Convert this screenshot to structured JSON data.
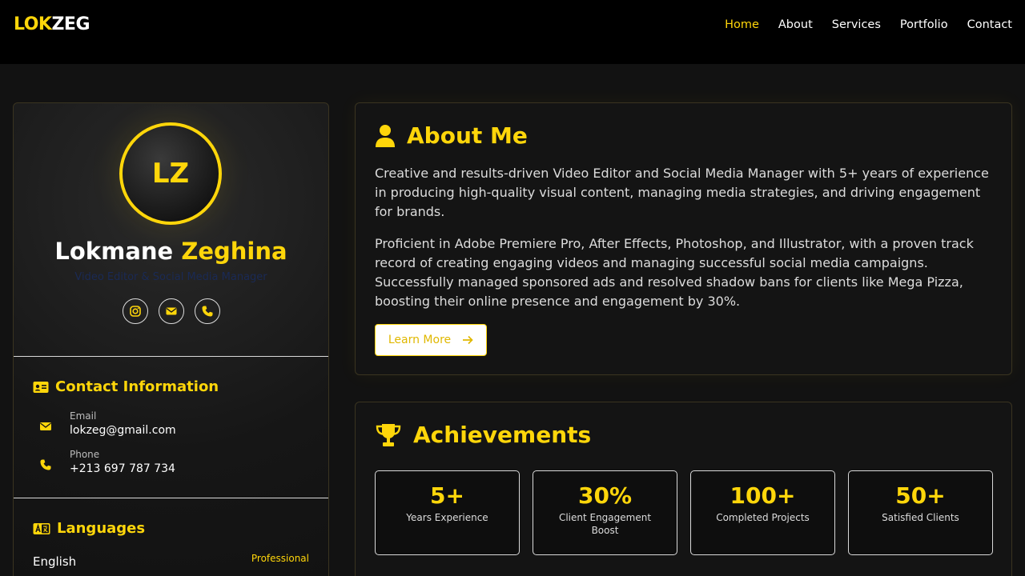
{
  "brand": {
    "part1": "LOK",
    "part2": "ZEG"
  },
  "nav": {
    "items": [
      {
        "label": "Home",
        "active": true
      },
      {
        "label": "About"
      },
      {
        "label": "Services"
      },
      {
        "label": "Portfolio"
      },
      {
        "label": "Contact"
      }
    ]
  },
  "profile": {
    "initials": "LZ",
    "first_name": "Lokmane",
    "last_name": "Zeghina",
    "role": "Video Editor & Social Media Manager",
    "socials": [
      "instagram-icon",
      "envelope-icon",
      "phone-icon"
    ]
  },
  "contact": {
    "title": "Contact Information",
    "email_label": "Email",
    "email_value": "lokzeg@gmail.com",
    "phone_label": "Phone",
    "phone_value": "+213 697 787 734"
  },
  "languages": {
    "title": "Languages",
    "items": [
      {
        "name": "English",
        "level": "Professional"
      }
    ]
  },
  "about": {
    "title": "About Me",
    "p1": "Creative and results-driven Video Editor and Social Media Manager with 5+ years of experience in producing high-quality visual content, managing media strategies, and driving engagement for brands.",
    "p2": "Proficient in Adobe Premiere Pro, After Effects, Photoshop, and Illustrator, with a proven track record of creating engaging videos and managing successful social media campaigns. Successfully managed sponsored ads and resolved shadow bans for clients like Mega Pizza, boosting their online presence and engagement by 30%.",
    "button": "Learn More"
  },
  "achievements": {
    "title": "Achievements",
    "stats": [
      {
        "value": "5+",
        "label": "Years Experience"
      },
      {
        "value": "30%",
        "label": "Client Engagement Boost"
      },
      {
        "value": "100+",
        "label": "Completed Projects"
      },
      {
        "value": "50+",
        "label": "Satisfied Clients"
      }
    ]
  },
  "colors": {
    "accent": "#ffd60a",
    "background": "#121212",
    "nav": "#000000"
  }
}
